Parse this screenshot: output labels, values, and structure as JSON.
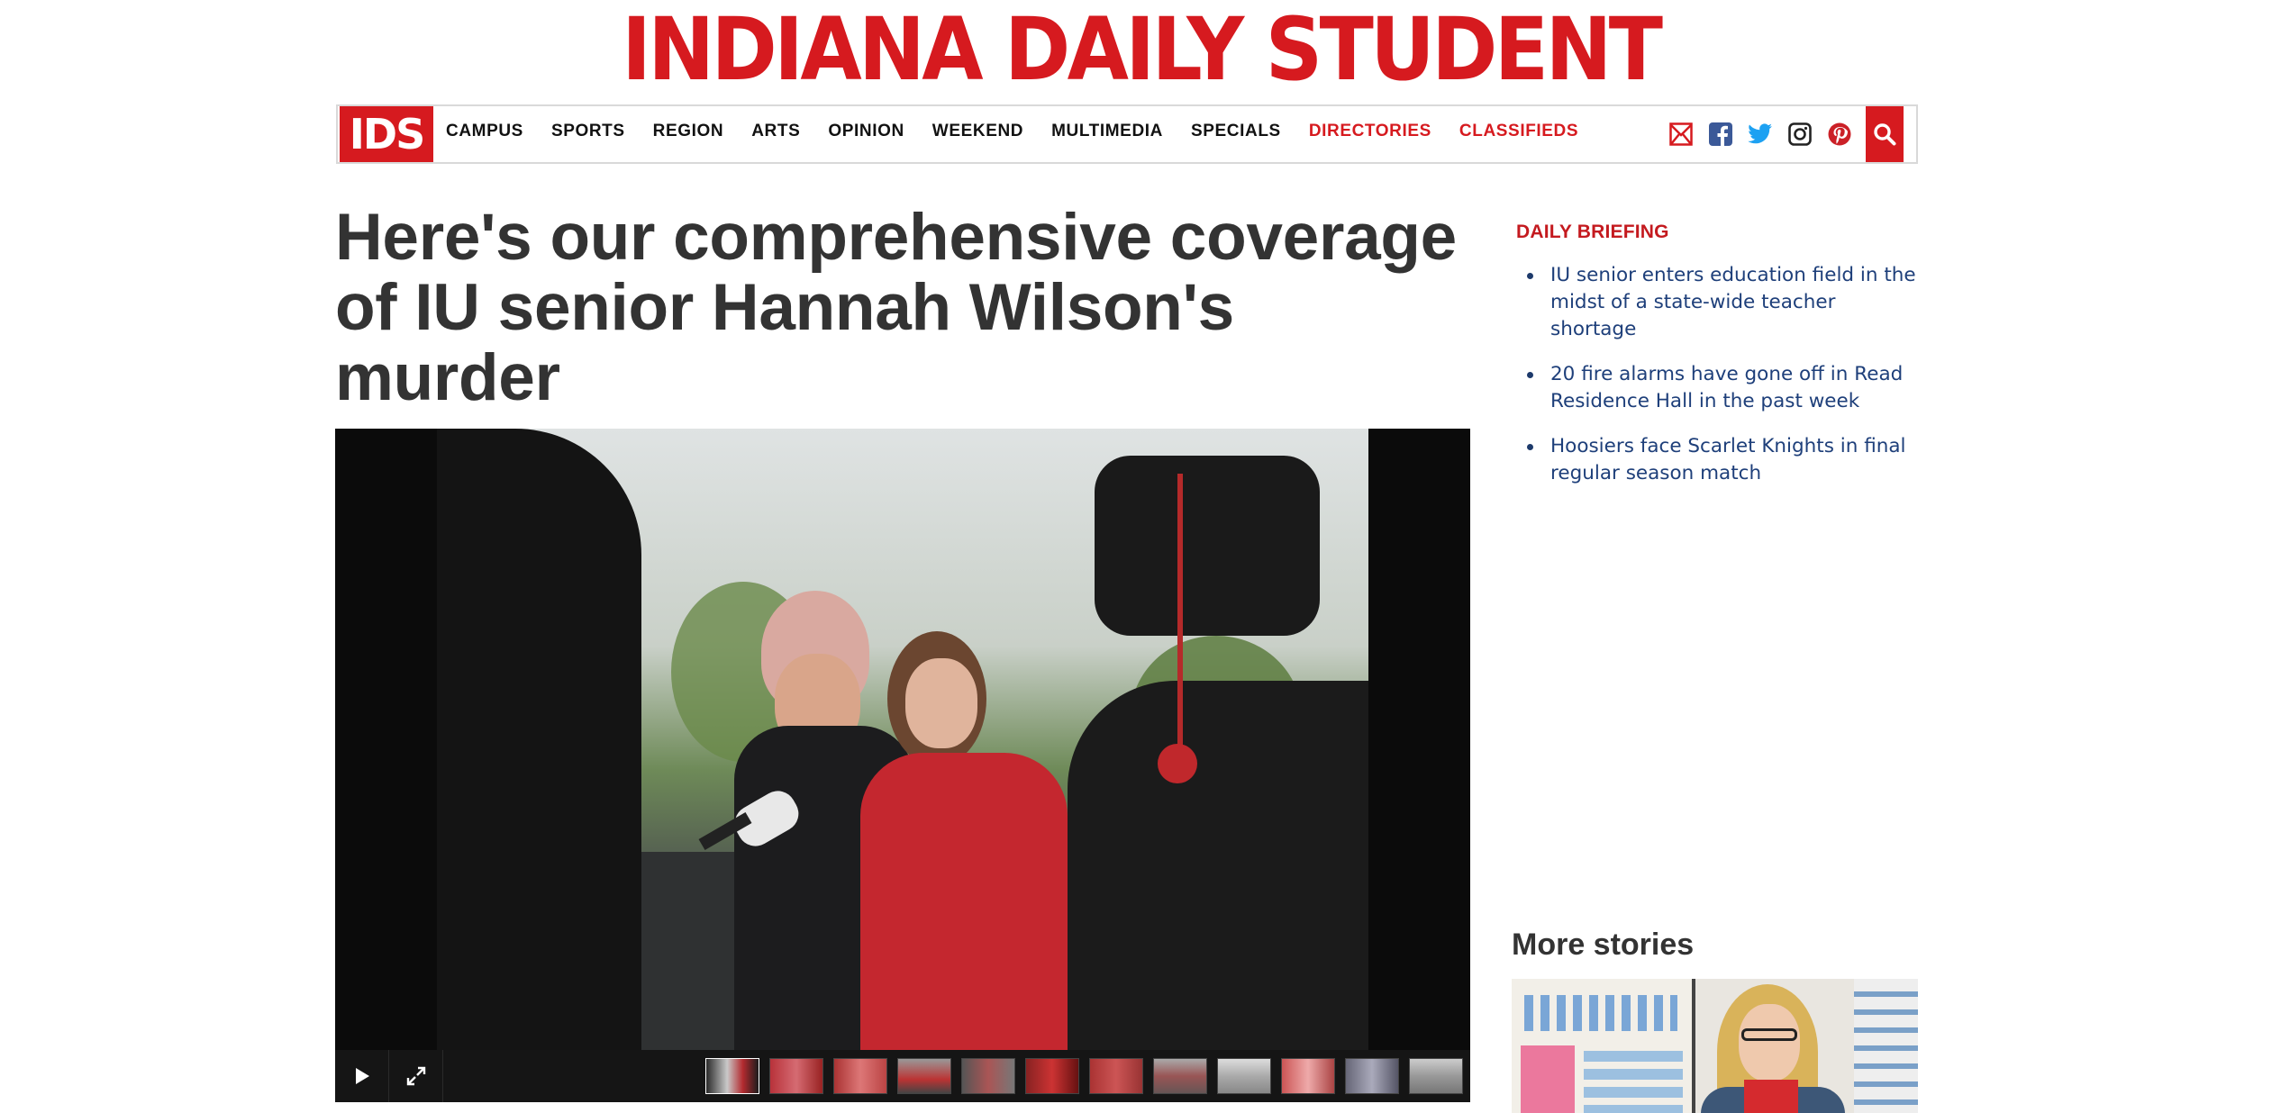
{
  "masthead": {
    "title": "INDIANA DAILY STUDENT"
  },
  "nav": {
    "logo": "IDS",
    "items": [
      {
        "label": "CAMPUS",
        "highlight": false
      },
      {
        "label": "SPORTS",
        "highlight": false
      },
      {
        "label": "REGION",
        "highlight": false
      },
      {
        "label": "ARTS",
        "highlight": false
      },
      {
        "label": "OPINION",
        "highlight": false
      },
      {
        "label": "WEEKEND",
        "highlight": false
      },
      {
        "label": "MULTIMEDIA",
        "highlight": false
      },
      {
        "label": "SPECIALS",
        "highlight": false
      },
      {
        "label": "DIRECTORIES",
        "highlight": true
      },
      {
        "label": "CLASSIFIEDS",
        "highlight": true
      }
    ],
    "icons": [
      "email-icon",
      "facebook-icon",
      "twitter-icon",
      "instagram-icon",
      "pinterest-icon"
    ],
    "search_icon": "search-icon"
  },
  "article": {
    "headline": "Here's our comprehensive coverage of IU senior Hannah Wilson's murder"
  },
  "gallery": {
    "controls": [
      "play-icon",
      "fullscreen-icon"
    ],
    "thumbnail_count": 12
  },
  "daily_briefing": {
    "title": "DAILY BRIEFING",
    "items": [
      "IU senior enters education field in the midst of a state-wide teacher shortage",
      "20 fire alarms have gone off in Read Residence Hall in the past week",
      "Hoosiers face Scarlet Knights in final regular season match"
    ]
  },
  "more_stories": {
    "title": "More stories"
  },
  "colors": {
    "brand_red": "#d61a1f",
    "link_blue": "#1e3f7a",
    "text_dark": "#333333"
  }
}
